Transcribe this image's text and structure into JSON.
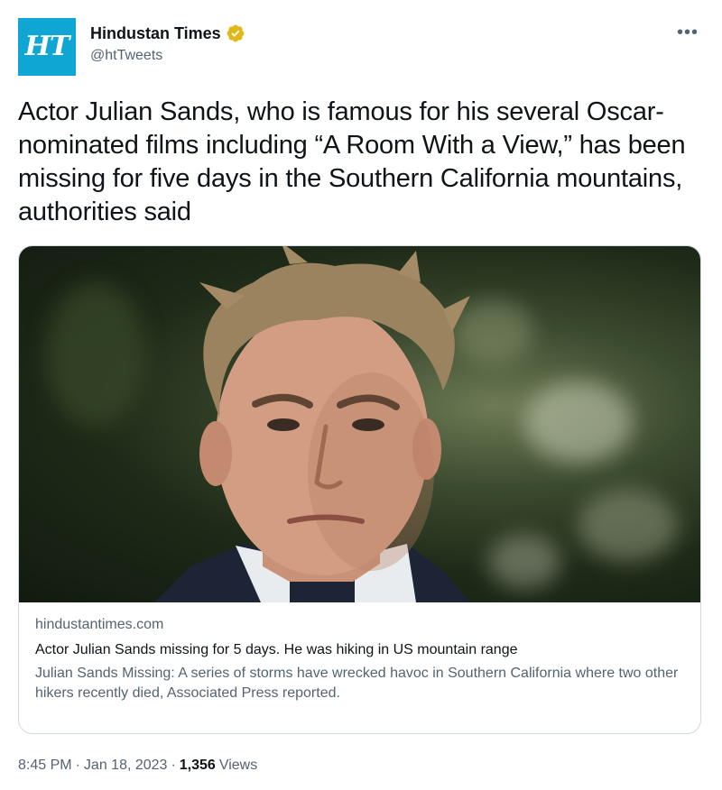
{
  "author": {
    "avatar_text": "HT",
    "display_name": "Hindustan Times",
    "handle": "@htTweets",
    "verified": true,
    "avatar_color": "#0fa6d4",
    "verified_color": "#e2b719"
  },
  "tweet": {
    "text": "Actor Julian Sands, who is famous for his several Oscar-nominated films including “A Room With a View,” has been missing for five days in the Southern California mountains, authorities said"
  },
  "card": {
    "domain": "hindustantimes.com",
    "title": "Actor Julian Sands missing for 5 days. He was hiking in US mountain range",
    "description": "Julian Sands Missing: A series of storms have wrecked havoc in Southern California where two other hikers recently died, Associated Press reported."
  },
  "meta": {
    "time": "8:45 PM",
    "separator": "·",
    "date": "Jan 18, 2023",
    "views_count": "1,356",
    "views_label": "Views"
  },
  "icons": {
    "more": "more-options-icon",
    "verified": "verified-badge-icon"
  }
}
